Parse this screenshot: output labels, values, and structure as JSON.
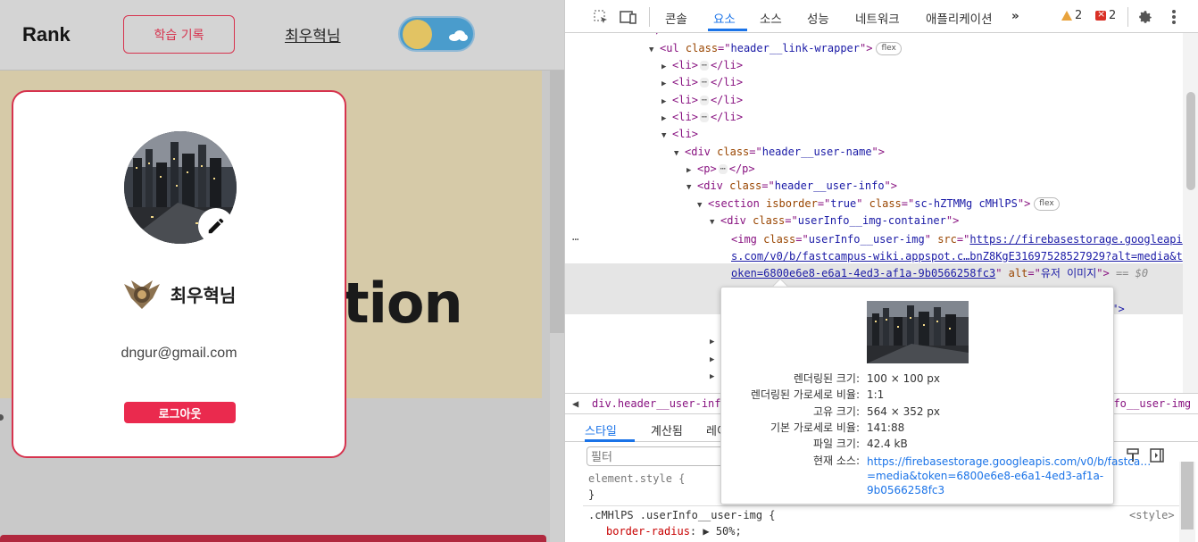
{
  "app": {
    "logo": "Rank",
    "history_button": "학습 기록",
    "user_link": "최우혁님",
    "banner_text": "tion"
  },
  "card": {
    "user_name": "최우혁님",
    "email": "dngur@gmail.com",
    "logout_button": "로그아웃"
  },
  "devtools": {
    "tabs": [
      "콘솔",
      "요소",
      "소스",
      "성능",
      "네트워크",
      "애플리케이션"
    ],
    "active_tab": "요소",
    "warnings": "2",
    "errors": "2",
    "dom": [
      {
        "pre": "▼",
        "tag": "ul",
        "attrs": [
          [
            "class",
            "header__link-wrapper"
          ]
        ],
        "pill": "flex"
      },
      {
        "pre": "▶",
        "tag": "li"
      },
      {
        "pre": "▶",
        "tag": "li"
      },
      {
        "pre": "▶",
        "tag": "li"
      },
      {
        "pre": "▶",
        "tag": "li"
      },
      {
        "pre": "▼",
        "tag": "li"
      },
      {
        "pre": "▼",
        "tag": "div",
        "attrs": [
          [
            "class",
            "header__user-name"
          ]
        ]
      },
      {
        "pre": "▶",
        "tag": "p"
      },
      {
        "pre": "▼",
        "tag": "div",
        "attrs": [
          [
            "class",
            "header__user-info"
          ]
        ]
      },
      {
        "pre": "▼",
        "tag": "section",
        "attrs": [
          [
            "isborder",
            "true"
          ],
          [
            "class",
            "sc-hZTMMg cMHlPS"
          ]
        ],
        "pill": "flex"
      },
      {
        "pre": "▼",
        "tag": "div",
        "attrs": [
          [
            "class",
            "userInfo__img-container"
          ]
        ]
      }
    ],
    "img_line": {
      "class": "userInfo__user-img",
      "src_1": "https://firebasestorage.googleapi",
      "src_2": "s.com/v0/b/fastcampus-wiki.appspot.c…bnZ8KgE31697528527929?alt=media&t",
      "src_3": "oken=6800e6e8-e6a1-4ed3-af1a-9b0566258fc3",
      "alt": "유저 이미지",
      "eq": "== $0"
    },
    "partial_right": "Q\">",
    "breadcrumb_left": "div.header__user-info",
    "breadcrumb_right": "info__user-img",
    "styles_tabs": [
      "스타일",
      "계산됨",
      "레이"
    ],
    "filter_placeholder": "필터",
    "element_style": "element.style {",
    "element_style_close": "}",
    "rule_selector": ".cMHlPS .userInfo__user-img {",
    "rule_source": "<style>",
    "rule_prop": "border-radius",
    "rule_value": "50%;"
  },
  "tooltip": {
    "rows": [
      {
        "label": "렌더링된 크기:",
        "value": "100 × 100 px"
      },
      {
        "label": "렌더링된 가로세로 비율:",
        "value": "1:1"
      },
      {
        "label": "고유 크기:",
        "value": "564 × 352 px"
      },
      {
        "label": "기본 가로세로 비율:",
        "value": "141:88"
      },
      {
        "label": "파일 크기:",
        "value": "42.4 kB"
      }
    ],
    "source_label": "현재 소스:",
    "source_value": "https://firebasestorage.googleapis.com/v0/b/fastca…=media&token=6800e6e8-e6a1-4ed3-af1a-9b0566258fc3"
  },
  "colors": {
    "accent": "#d6334e",
    "logout": "#ea2a4e",
    "devtools_blue": "#1a73e8"
  }
}
